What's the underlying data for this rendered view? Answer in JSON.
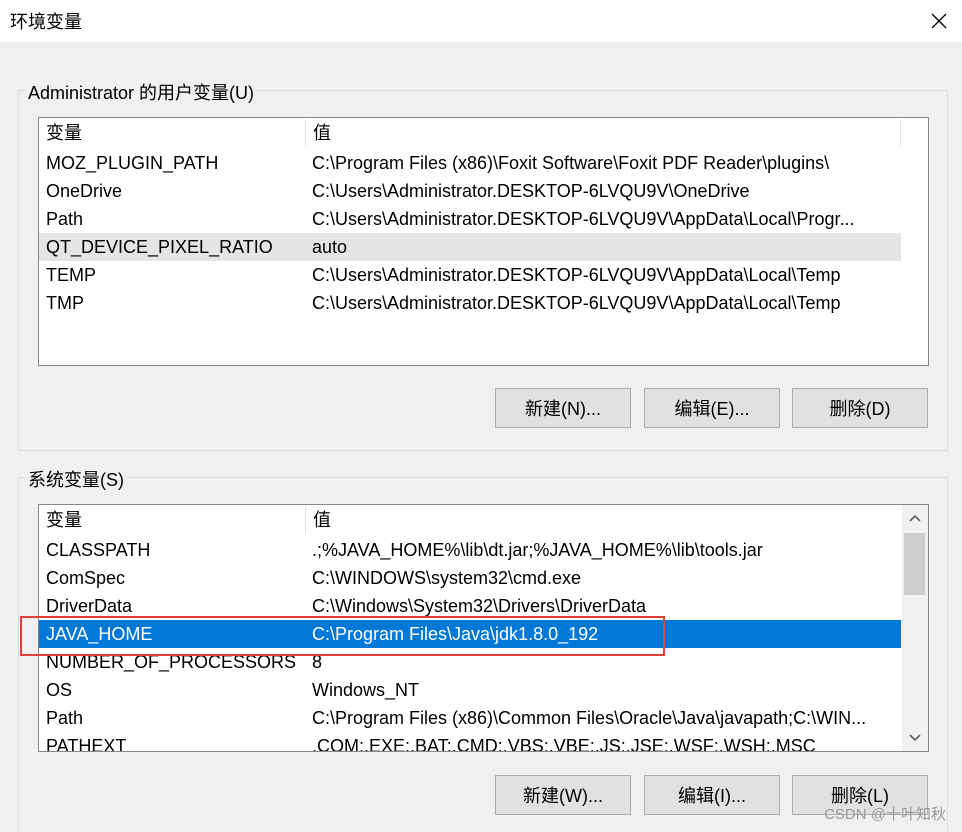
{
  "window": {
    "title": "环境变量",
    "close_icon": "close-icon"
  },
  "user_vars": {
    "legend": "Administrator 的用户变量(U)",
    "col_name": "变量",
    "col_value": "值",
    "rows": [
      {
        "name": "MOZ_PLUGIN_PATH",
        "value": "C:\\Program Files (x86)\\Foxit Software\\Foxit PDF Reader\\plugins\\"
      },
      {
        "name": "OneDrive",
        "value": "C:\\Users\\Administrator.DESKTOP-6LVQU9V\\OneDrive"
      },
      {
        "name": "Path",
        "value": "C:\\Users\\Administrator.DESKTOP-6LVQU9V\\AppData\\Local\\Progr..."
      },
      {
        "name": "QT_DEVICE_PIXEL_RATIO",
        "value": "auto"
      },
      {
        "name": "TEMP",
        "value": "C:\\Users\\Administrator.DESKTOP-6LVQU9V\\AppData\\Local\\Temp"
      },
      {
        "name": "TMP",
        "value": "C:\\Users\\Administrator.DESKTOP-6LVQU9V\\AppData\\Local\\Temp"
      }
    ],
    "hover_row": "QT_DEVICE_PIXEL_RATIO",
    "buttons": {
      "new": "新建(N)...",
      "edit": "编辑(E)...",
      "delete": "删除(D)"
    }
  },
  "system_vars": {
    "legend": "系统变量(S)",
    "col_name": "变量",
    "col_value": "值",
    "rows": [
      {
        "name": "CLASSPATH",
        "value": ".;%JAVA_HOME%\\lib\\dt.jar;%JAVA_HOME%\\lib\\tools.jar"
      },
      {
        "name": "ComSpec",
        "value": "C:\\WINDOWS\\system32\\cmd.exe"
      },
      {
        "name": "DriverData",
        "value": "C:\\Windows\\System32\\Drivers\\DriverData"
      },
      {
        "name": "JAVA_HOME",
        "value": "C:\\Program Files\\Java\\jdk1.8.0_192"
      },
      {
        "name": "NUMBER_OF_PROCESSORS",
        "value": "8"
      },
      {
        "name": "OS",
        "value": "Windows_NT"
      },
      {
        "name": "Path",
        "value": "C:\\Program Files (x86)\\Common Files\\Oracle\\Java\\javapath;C:\\WIN..."
      },
      {
        "name": "PATHEXT",
        "value": ".COM;.EXE;.BAT;.CMD;.VBS;.VBE;.JS;.JSE;.WSF;.WSH;.MSC"
      }
    ],
    "selected_row": "JAVA_HOME",
    "buttons": {
      "new": "新建(W)...",
      "edit": "编辑(I)...",
      "delete": "删除(L)"
    }
  },
  "watermark": "CSDN @十叶知秋",
  "colors": {
    "selection": "#0078d7",
    "annotation_box": "#e0403c",
    "hover": "#e5e5e5"
  }
}
